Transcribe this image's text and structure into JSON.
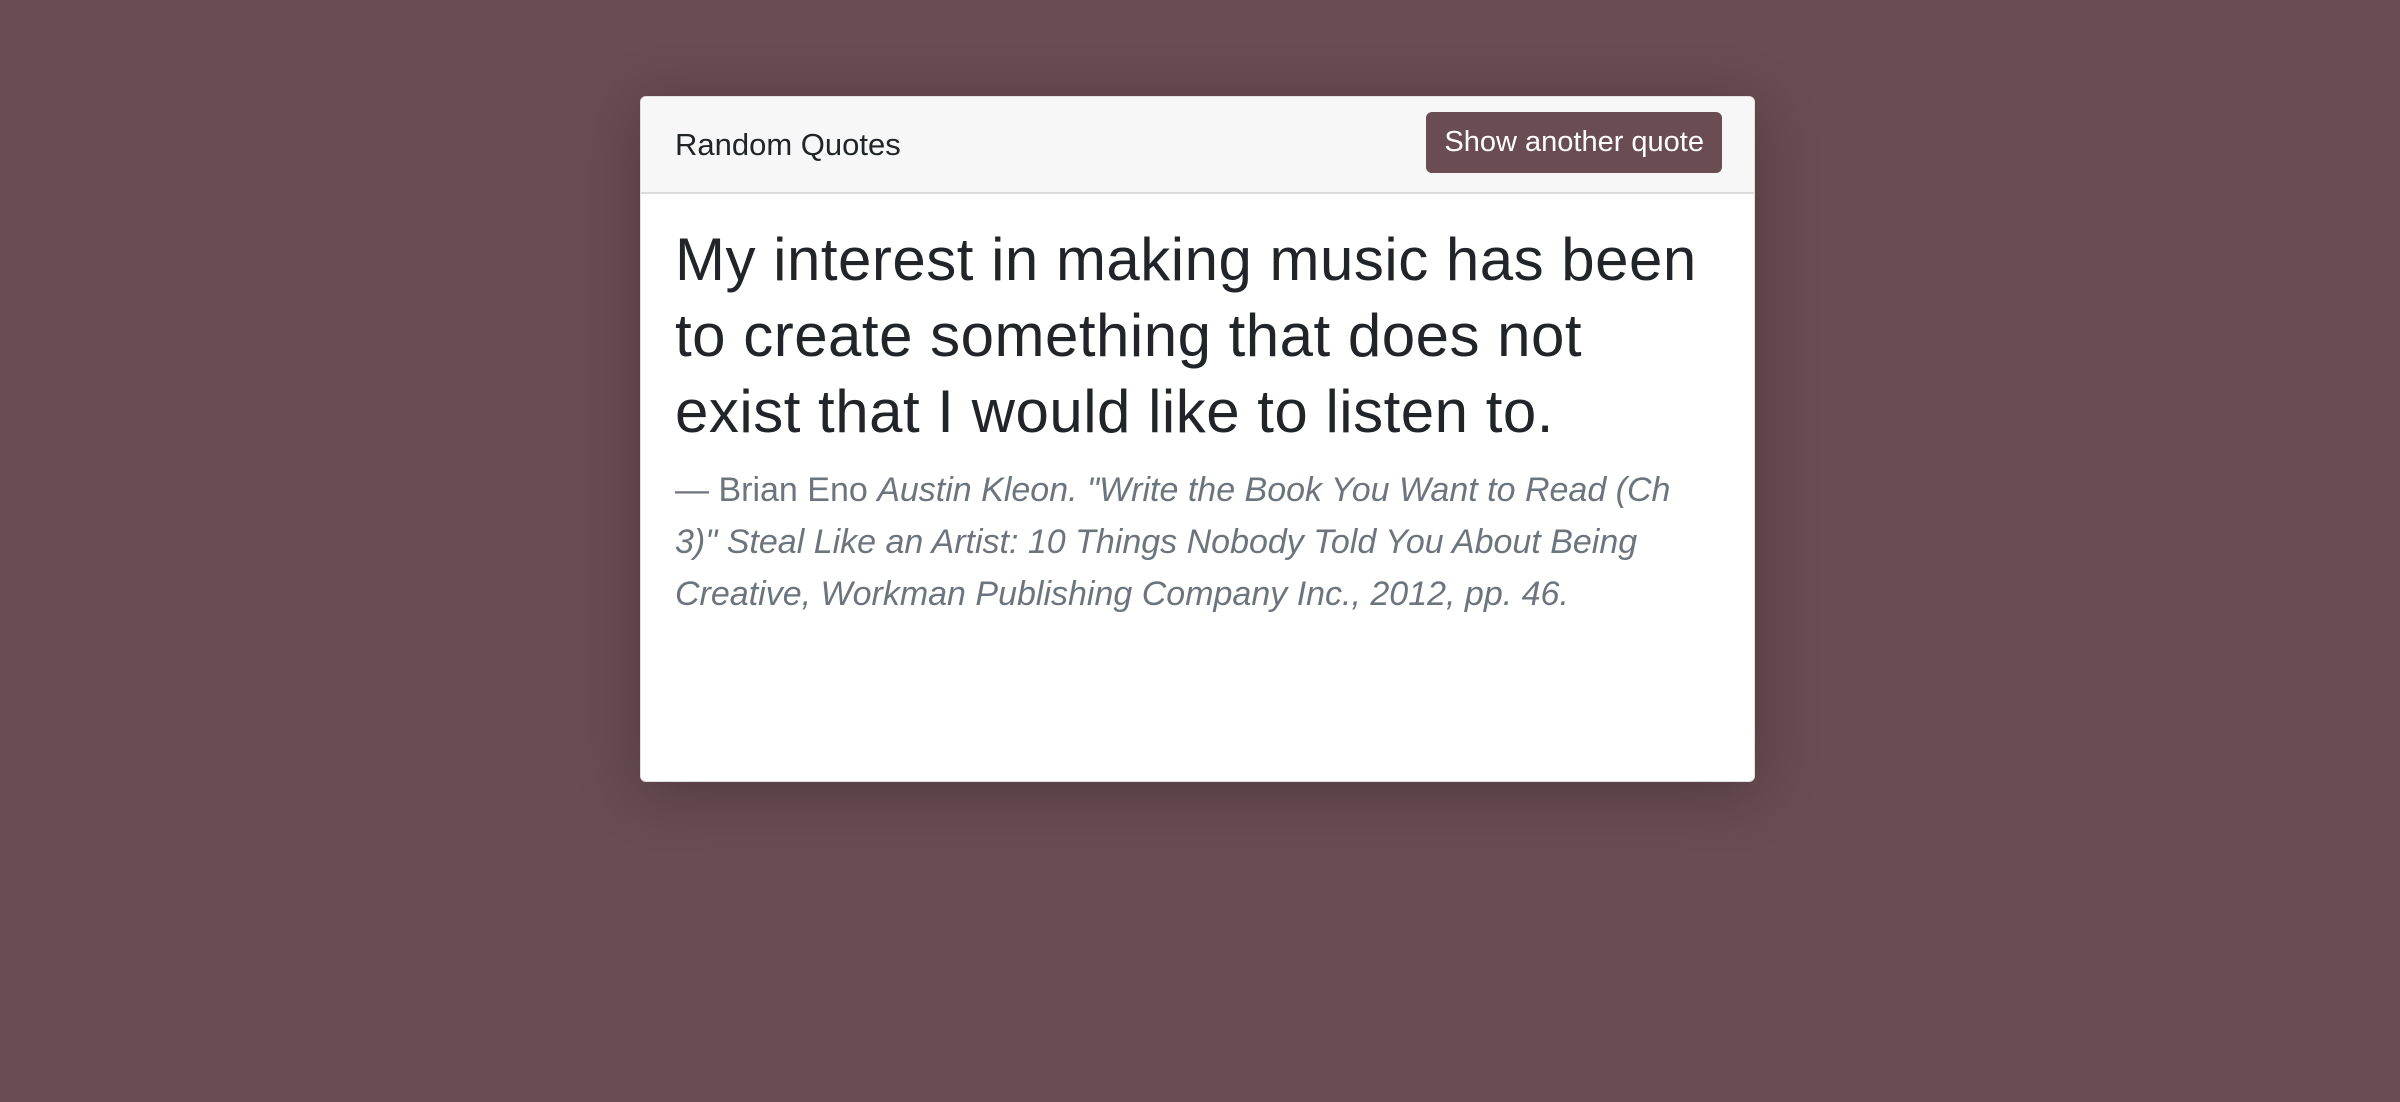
{
  "header": {
    "title": "Random Quotes",
    "button_label": "Show another quote"
  },
  "quote": {
    "text": "My interest in making music has been to create something that does not exist that I would like to listen to.",
    "author": "— Brian Eno",
    "source": "Austin Kleon. \"Write the Book You Want to Read (Ch 3)\" Steal Like an Artist: 10 Things Nobody Told You About Being Creative, Workman Publishing Company Inc., 2012, pp. 46."
  },
  "colors": {
    "background": "#6a4c53",
    "accent": "#6a4c53"
  }
}
